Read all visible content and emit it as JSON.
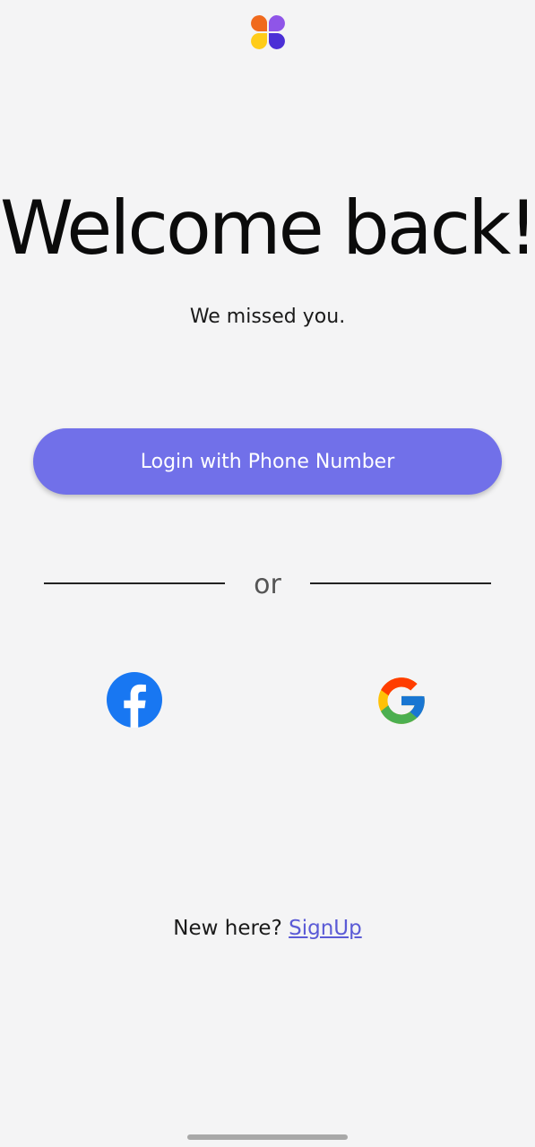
{
  "app": {
    "logo_icon": "four-petal-logo-icon",
    "logo_colors": [
      "#f06a1d",
      "#8f55e8",
      "#ffcc1a",
      "#4b2fd6"
    ]
  },
  "header": {
    "title": "Welcome back!",
    "subtitle": "We missed you."
  },
  "login": {
    "phone_button_label": "Login with Phone Number",
    "accent_color": "#7170e9"
  },
  "divider": {
    "label": "or"
  },
  "social": {
    "facebook_icon": "facebook-icon",
    "google_icon": "google-icon"
  },
  "footer": {
    "prompt": "New here? ",
    "signup_label": "SignUp"
  }
}
